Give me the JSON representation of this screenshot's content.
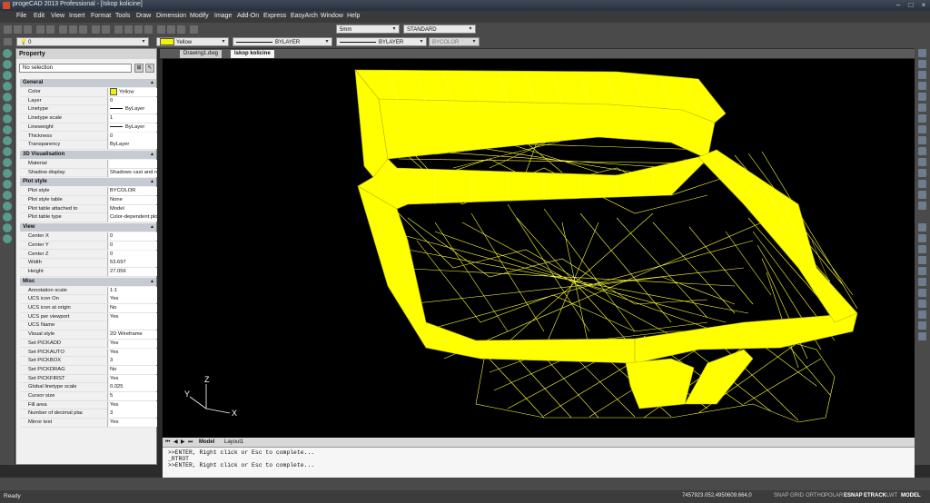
{
  "window": {
    "title": "progeCAD 2013 Professional - [Iskop kolicine]"
  },
  "menu": [
    "File",
    "Edit",
    "View",
    "Insert",
    "Format",
    "Tools",
    "Draw",
    "Dimension",
    "Modify",
    "Image",
    "Add-On",
    "Express",
    "EasyArch",
    "Window",
    "Help"
  ],
  "toolbar": {
    "layer_value": "0",
    "color_value": "Yellow",
    "linetype_value": "BYLAYER",
    "lineweight_value": "BYLAYER",
    "plotstyle_value": "BYCOLOR",
    "dimscale_value": "5mm",
    "textstyle_value": "STANDARD",
    "accent_color": "#f2f200"
  },
  "property_panel": {
    "title": "Property",
    "selection": "No selection",
    "sections": [
      {
        "name": "General",
        "rows": [
          [
            "Color",
            "Yellow"
          ],
          [
            "Layer",
            "0"
          ],
          [
            "Linetype",
            "ByLayer"
          ],
          [
            "Linetype scale",
            "1"
          ],
          [
            "Lineweight",
            "ByLayer"
          ],
          [
            "Thickness",
            "0"
          ],
          [
            "Transparency",
            "ByLayer"
          ]
        ]
      },
      {
        "name": "3D Visualisation",
        "rows": [
          [
            "Material",
            ""
          ],
          [
            "Shadow display",
            "Shadows cast and recei..."
          ]
        ]
      },
      {
        "name": "Plot style",
        "rows": [
          [
            "Plot style",
            "BYCOLOR"
          ],
          [
            "Plot style table",
            "None"
          ],
          [
            "Plot table attached to",
            "Model"
          ],
          [
            "Plot table type",
            "Color-dependent plot style"
          ]
        ]
      },
      {
        "name": "View",
        "rows": [
          [
            "Center X",
            "0"
          ],
          [
            "Center Y",
            "0"
          ],
          [
            "Center Z",
            "0"
          ],
          [
            "Width",
            "53.697"
          ],
          [
            "Height",
            "27.056"
          ]
        ]
      },
      {
        "name": "Misc",
        "rows": [
          [
            "Annotation scale",
            "1:1"
          ],
          [
            "UCS icon On",
            "Yes"
          ],
          [
            "UCS icon at origin",
            "No"
          ],
          [
            "UCS per viewport",
            "Yes"
          ],
          [
            "UCS Name",
            ""
          ],
          [
            "Visual style",
            "2D Wireframe"
          ],
          [
            "Set PICKADD",
            "Yes"
          ],
          [
            "Set PICKAUTO",
            "Yes"
          ],
          [
            "Set PICKBOX",
            "3"
          ],
          [
            "Set PICKDRAG",
            "No"
          ],
          [
            "Set PICKFIRST",
            "Yes"
          ],
          [
            "Global linetype scale",
            "0.025"
          ],
          [
            "Cursor size",
            "5"
          ],
          [
            "Fill area",
            "Yes"
          ],
          [
            "Number of decimal places",
            "3"
          ],
          [
            "Mirror text",
            "Yes"
          ]
        ]
      }
    ]
  },
  "doc_tabs": [
    "Drawing1.dwg",
    "Iskop kolicine"
  ],
  "layout_tabs": [
    "Model",
    "Layout1"
  ],
  "ucs": {
    "x_label": "X",
    "y_label": "Y",
    "z_label": "Z"
  },
  "command_lines": [
    ">>ENTER, Right click or Esc to complete...",
    "_RTROT",
    ">>ENTER, Right click or Esc to complete..."
  ],
  "status": {
    "ready": "Ready",
    "coords": "7457923.052,4950609.664,0",
    "buttons": [
      "SNAP",
      "GRID",
      "ORTHO",
      "POLAR",
      "ESNAP",
      "ETRACK",
      "LWT",
      "MODEL"
    ],
    "active": [
      "ESNAP",
      "ETRACK",
      "MODEL"
    ]
  }
}
